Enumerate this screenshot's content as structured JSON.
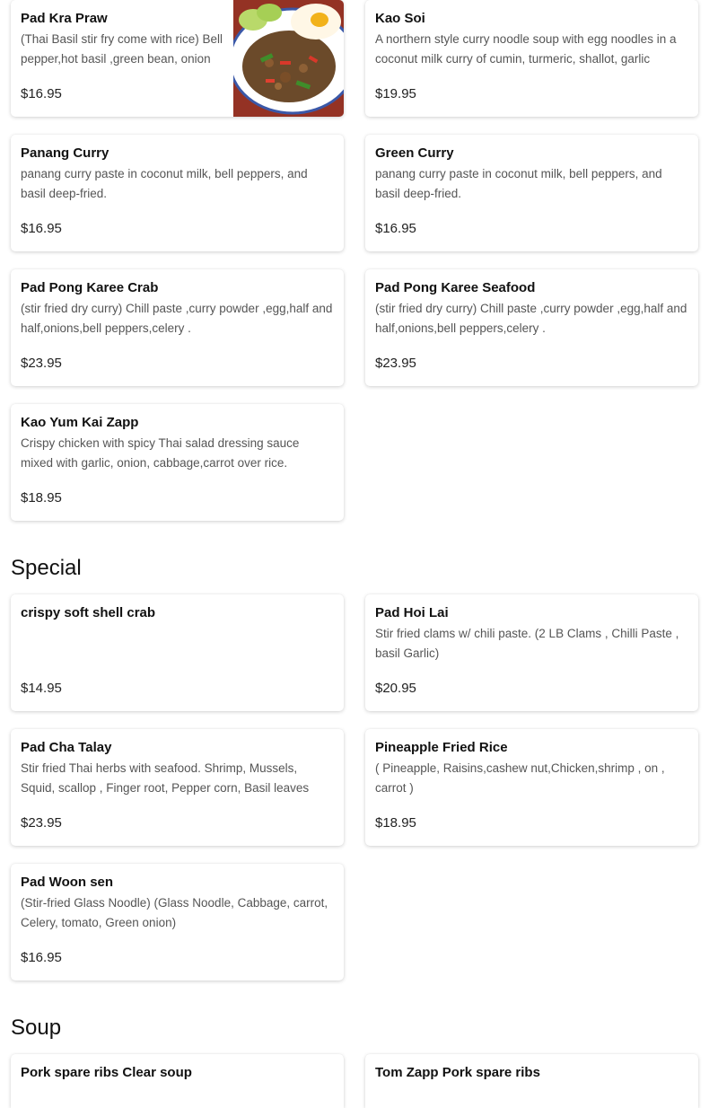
{
  "sections": [
    {
      "title": "",
      "items": [
        {
          "name": "Pad Kra Praw",
          "desc": "(Thai Basil stir fry come with rice) Bell pepper,hot basil ,green bean, onion",
          "price": "$16.95",
          "image": "basil-stir-fry-photo"
        },
        {
          "name": "Kao Soi",
          "desc": "A northern style curry noodle soup with egg noodles in a coconut milk curry of cumin, turmeric, shallot, garlic",
          "price": "$19.95"
        },
        {
          "name": "Panang Curry",
          "desc": "panang curry paste in coconut milk, bell peppers, and basil deep-fried.",
          "price": "$16.95"
        },
        {
          "name": "Green Curry",
          "desc": "panang curry paste in coconut milk, bell peppers, and basil deep-fried.",
          "price": "$16.95"
        },
        {
          "name": "Pad Pong Karee Crab",
          "desc": "(stir fried dry curry) Chill paste ,curry powder ,egg,half and half,onions,bell peppers,celery .",
          "price": "$23.95"
        },
        {
          "name": "Pad Pong Karee Seafood",
          "desc": "(stir fried dry curry) Chill paste ,curry powder ,egg,half and half,onions,bell peppers,celery .",
          "price": "$23.95"
        },
        {
          "name": "Kao Yum Kai Zapp",
          "desc": "Crispy chicken with spicy Thai salad dressing sauce mixed with garlic, onion, cabbage,carrot over rice.",
          "price": "$18.95"
        }
      ]
    },
    {
      "title": "Special",
      "items": [
        {
          "name": "crispy soft shell crab",
          "desc": "",
          "price": "$14.95"
        },
        {
          "name": "Pad Hoi Lai",
          "desc": "Stir fried clams w/ chili paste. (2 LB Clams , Chilli Paste , basil Garlic)",
          "price": "$20.95"
        },
        {
          "name": "Pad Cha Talay",
          "desc": "Stir fried Thai herbs with seafood. Shrimp, Mussels, Squid, scallop , Finger root, Pepper corn, Basil leaves",
          "price": "$23.95"
        },
        {
          "name": "Pineapple Fried Rice",
          "desc": "( Pineapple, Raisins,cashew nut,Chicken,shrimp , on , carrot )",
          "price": "$18.95"
        },
        {
          "name": "Pad Woon sen",
          "desc": "(Stir-fried Glass Noodle) (Glass Noodle, Cabbage, carrot, Celery, tomato, Green onion)",
          "price": "$16.95"
        }
      ]
    },
    {
      "title": "Soup",
      "items": [
        {
          "name": "Pork spare ribs Clear soup",
          "desc": "",
          "price": ""
        },
        {
          "name": "Tom Zapp Pork spare ribs",
          "desc": "",
          "price": ""
        }
      ]
    }
  ]
}
